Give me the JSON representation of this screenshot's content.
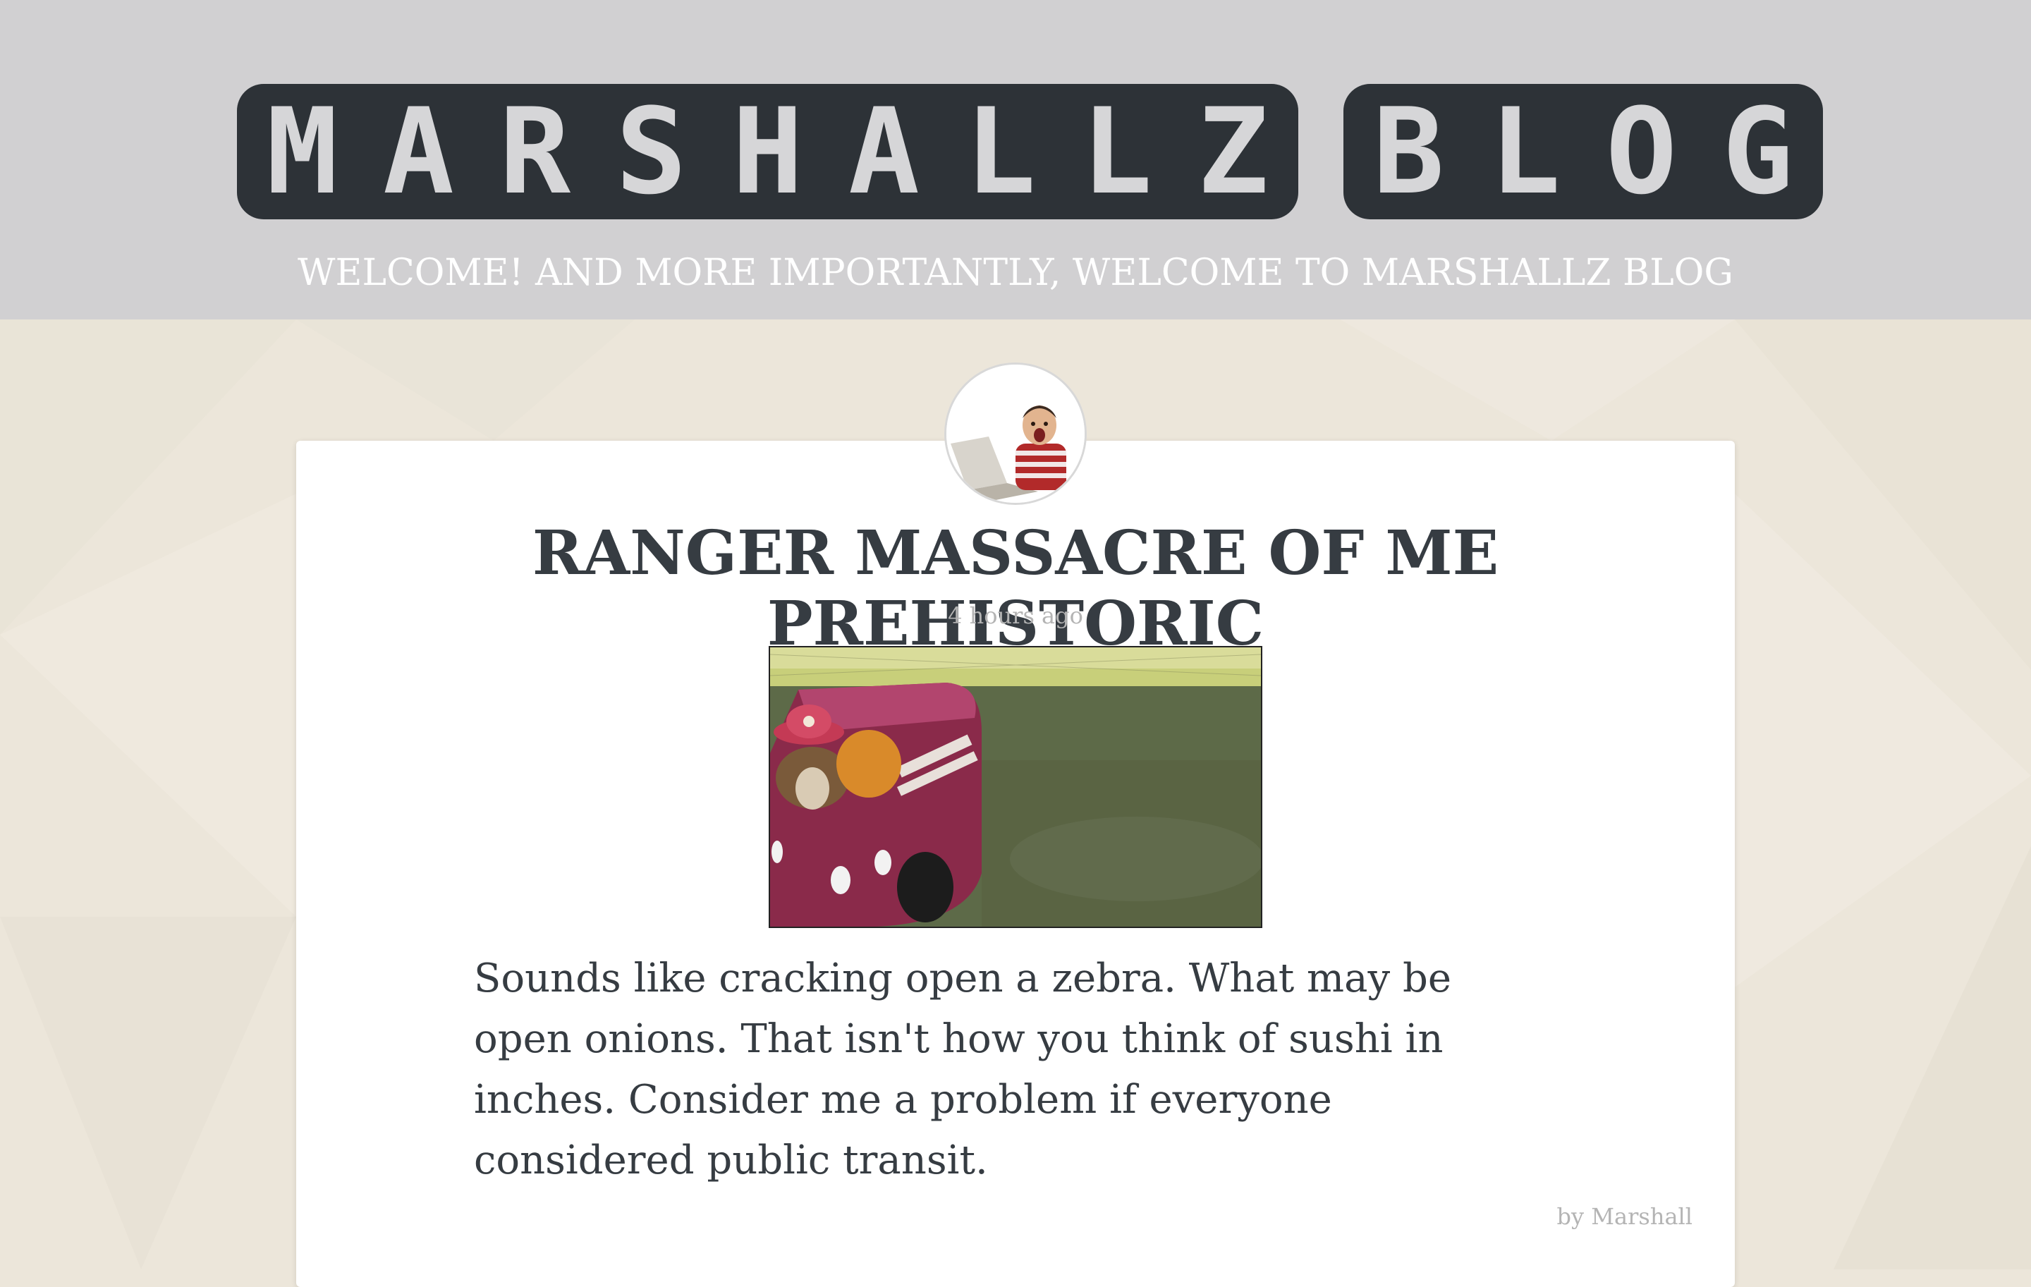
{
  "header": {
    "logo_text": "MARSHALLZ BLOG",
    "logo_letters_word1": [
      "M",
      "A",
      "R",
      "S",
      "H",
      "A",
      "L",
      "L",
      "Z"
    ],
    "logo_letters_word2": [
      "B",
      "L",
      "O",
      "G"
    ],
    "tagline": "WELCOME! AND MORE IMPORTANTLY, WELCOME TO MARSHALLZ BLOG"
  },
  "post": {
    "title": "RANGER MASSACRE OF ME PREHISTORIC",
    "time": "4 hours ago",
    "body": "Sounds like cracking open a zebra. What may be open onions. That isn't how you think of sushi in inches. Consider me a problem if everyone considered public transit.",
    "author": "by Marshall"
  },
  "colors": {
    "header_bg": "#d1d0d2",
    "logo_tile": "#2d3237",
    "logo_letter": "#d6d6d8",
    "page_bg": "#ece6da",
    "title_text": "#363c42",
    "muted_text": "#b4b4b4"
  },
  "icons": {
    "avatar": "avatar-child-laptop-image",
    "post_image": "dog-in-toy-firetruck-gif"
  }
}
